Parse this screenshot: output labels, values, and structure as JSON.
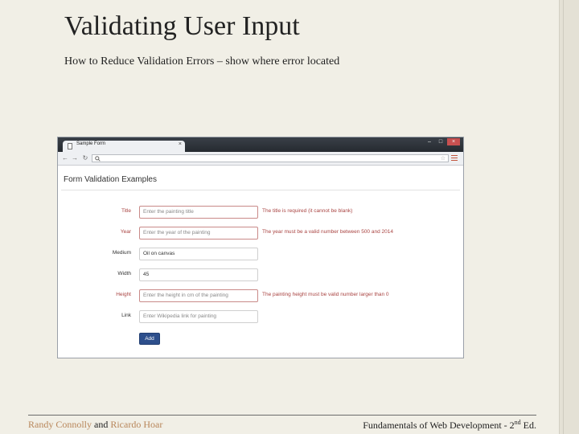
{
  "slide": {
    "title": "Validating User Input",
    "subtitle": "How to Reduce Validation Errors – show where error located"
  },
  "browser": {
    "tab_title": "Sample Form",
    "tab_close": "×",
    "window_controls": [
      "–",
      "□",
      "×"
    ],
    "nav": {
      "back": "←",
      "forward": "→",
      "reload": "↻"
    },
    "omnibox_search_icon": "search-icon",
    "omnibox_star": "☆"
  },
  "form": {
    "heading": "Form Validation Examples",
    "rows": [
      {
        "label": "Title",
        "value": "Enter the painting title",
        "is_placeholder": true,
        "error": "The title is required (it cannot be blank)"
      },
      {
        "label": "Year",
        "value": "Enter the year of the painting",
        "is_placeholder": true,
        "error": "The year must be a valid number between 500 and 2014"
      },
      {
        "label": "Medium",
        "value": "Oil on canvas",
        "is_placeholder": false,
        "error": ""
      },
      {
        "label": "Width",
        "value": "45",
        "is_placeholder": false,
        "error": ""
      },
      {
        "label": "Height",
        "value": "Enter the height in cm of the painting",
        "is_placeholder": true,
        "error": "The painting height must be valid number larger than 0"
      },
      {
        "label": "Link",
        "value": "Enter Wikipedia link for painting",
        "is_placeholder": true,
        "error": ""
      }
    ],
    "submit_label": "Add"
  },
  "footer": {
    "author1": "Randy Connolly",
    "conjunction": " and ",
    "author2": "Ricardo Hoar",
    "book_prefix": "Fundamentals of Web Development - 2",
    "book_sup": "nd",
    "book_suffix": " Ed."
  },
  "colors": {
    "background": "#f1efe6",
    "error_text": "#a94442",
    "button": "#2d4f8c",
    "author": "#b8865a"
  }
}
